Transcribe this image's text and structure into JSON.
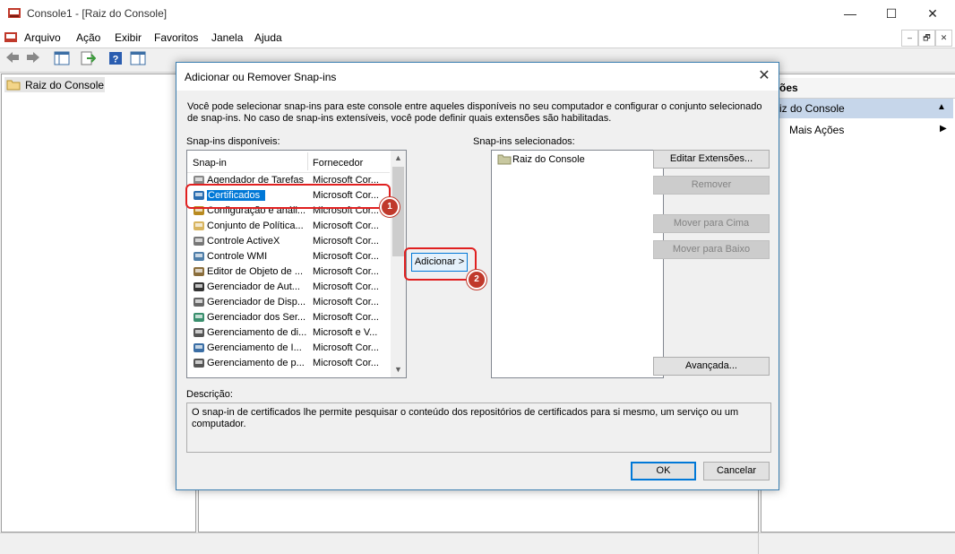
{
  "window": {
    "title": "Console1 - [Raiz do Console]",
    "minimize": "—",
    "maximize": "☐",
    "close": "✕"
  },
  "menu": [
    "Arquivo",
    "Ação",
    "Exibir",
    "Favoritos",
    "Janela",
    "Ajuda"
  ],
  "mdi_controls": [
    "–",
    "🗗",
    "✕"
  ],
  "tree": {
    "root_label": "Raiz do Console"
  },
  "actions_pane": {
    "header": "ões",
    "section": "iz do Console",
    "more_actions": "Mais Ações"
  },
  "dialog": {
    "title": "Adicionar ou Remover Snap-ins",
    "intro": "Você pode selecionar snap-ins para este console entre aqueles disponíveis no seu computador e configurar o conjunto selecionado de snap-ins. No caso de snap-ins extensíveis, você pode definir quais extensões são habilitadas.",
    "available_label": "Snap-ins disponíveis:",
    "selected_label": "Snap-ins selecionados:",
    "columns": {
      "snapin": "Snap-in",
      "vendor": "Fornecedor"
    },
    "available": [
      {
        "name": "Agendador de Tarefas",
        "vendor": "Microsoft Cor...",
        "icon": "clock-icon"
      },
      {
        "name": "Certificados",
        "vendor": "Microsoft Cor...",
        "icon": "certificate-icon"
      },
      {
        "name": "Configuração e análi...",
        "vendor": "Microsoft Cor...",
        "icon": "security-config-icon"
      },
      {
        "name": "Conjunto de Política...",
        "vendor": "Microsoft Cor...",
        "icon": "policy-icon"
      },
      {
        "name": "Controle ActiveX",
        "vendor": "Microsoft Cor...",
        "icon": "activex-icon"
      },
      {
        "name": "Controle WMI",
        "vendor": "Microsoft Cor...",
        "icon": "wmi-icon"
      },
      {
        "name": "Editor de Objeto de ...",
        "vendor": "Microsoft Cor...",
        "icon": "gpo-editor-icon"
      },
      {
        "name": "Gerenciador de Aut...",
        "vendor": "Microsoft Cor...",
        "icon": "authorization-icon"
      },
      {
        "name": "Gerenciador de Disp...",
        "vendor": "Microsoft Cor...",
        "icon": "device-manager-icon"
      },
      {
        "name": "Gerenciador dos Ser...",
        "vendor": "Microsoft Cor...",
        "icon": "server-manager-icon"
      },
      {
        "name": "Gerenciamento de di...",
        "vendor": "Microsoft e V...",
        "icon": "disk-management-icon"
      },
      {
        "name": "Gerenciamento de I...",
        "vendor": "Microsoft Cor...",
        "icon": "ip-management-icon"
      },
      {
        "name": "Gerenciamento de p...",
        "vendor": "Microsoft Cor...",
        "icon": "print-management-icon"
      }
    ],
    "selected": [
      {
        "name": "Raiz do Console",
        "icon": "folder-icon"
      }
    ],
    "add_button": "Adicionar >",
    "edit_extensions": "Editar Extensões...",
    "remove": "Remover",
    "move_up": "Mover para Cima",
    "move_down": "Mover para Baixo",
    "advanced": "Avançada...",
    "description_label": "Descrição:",
    "description": "O snap-in de certificados lhe permite pesquisar o conteúdo dos repositórios de certificados para si mesmo, um serviço ou um computador.",
    "ok": "OK",
    "cancel": "Cancelar"
  },
  "callouts": [
    "1",
    "2"
  ],
  "colors": {
    "selection": "#0078d7",
    "annotation": "#e02020",
    "accent": "#3c7fb1"
  }
}
